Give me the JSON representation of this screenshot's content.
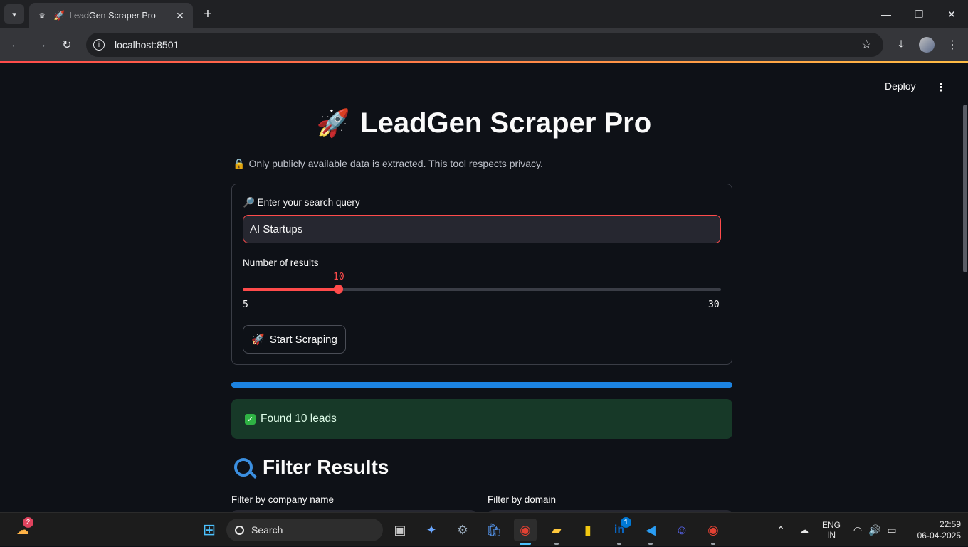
{
  "browser": {
    "tab_title": "LeadGen Scraper Pro",
    "url": "localhost:8501"
  },
  "app": {
    "deploy_label": "Deploy",
    "title": "LeadGen Scraper Pro",
    "privacy_note": "Only publicly available data is extracted. This tool respects privacy.",
    "query_label": "🔎 Enter your search query",
    "query_value": "AI Startups",
    "results_label": "Number of results",
    "slider": {
      "value": 10,
      "min": 5,
      "max": 30,
      "value_text": "10",
      "min_text": "5",
      "max_text": "30"
    },
    "start_button": "Start Scraping",
    "progress": 1.0,
    "success_message": "Found 10 leads",
    "filter_heading": "Filter Results",
    "filter_company_label": "Filter by company name",
    "filter_domain_label": "Filter by domain",
    "accent_color": "#ff4b4b",
    "progress_color": "#1c83e1"
  },
  "taskbar": {
    "search_placeholder": "Search",
    "weather_badge": "2",
    "linkedin_badge": "1",
    "lang_top": "ENG",
    "lang_bottom": "IN",
    "time": "22:59",
    "date": "06-04-2025"
  }
}
